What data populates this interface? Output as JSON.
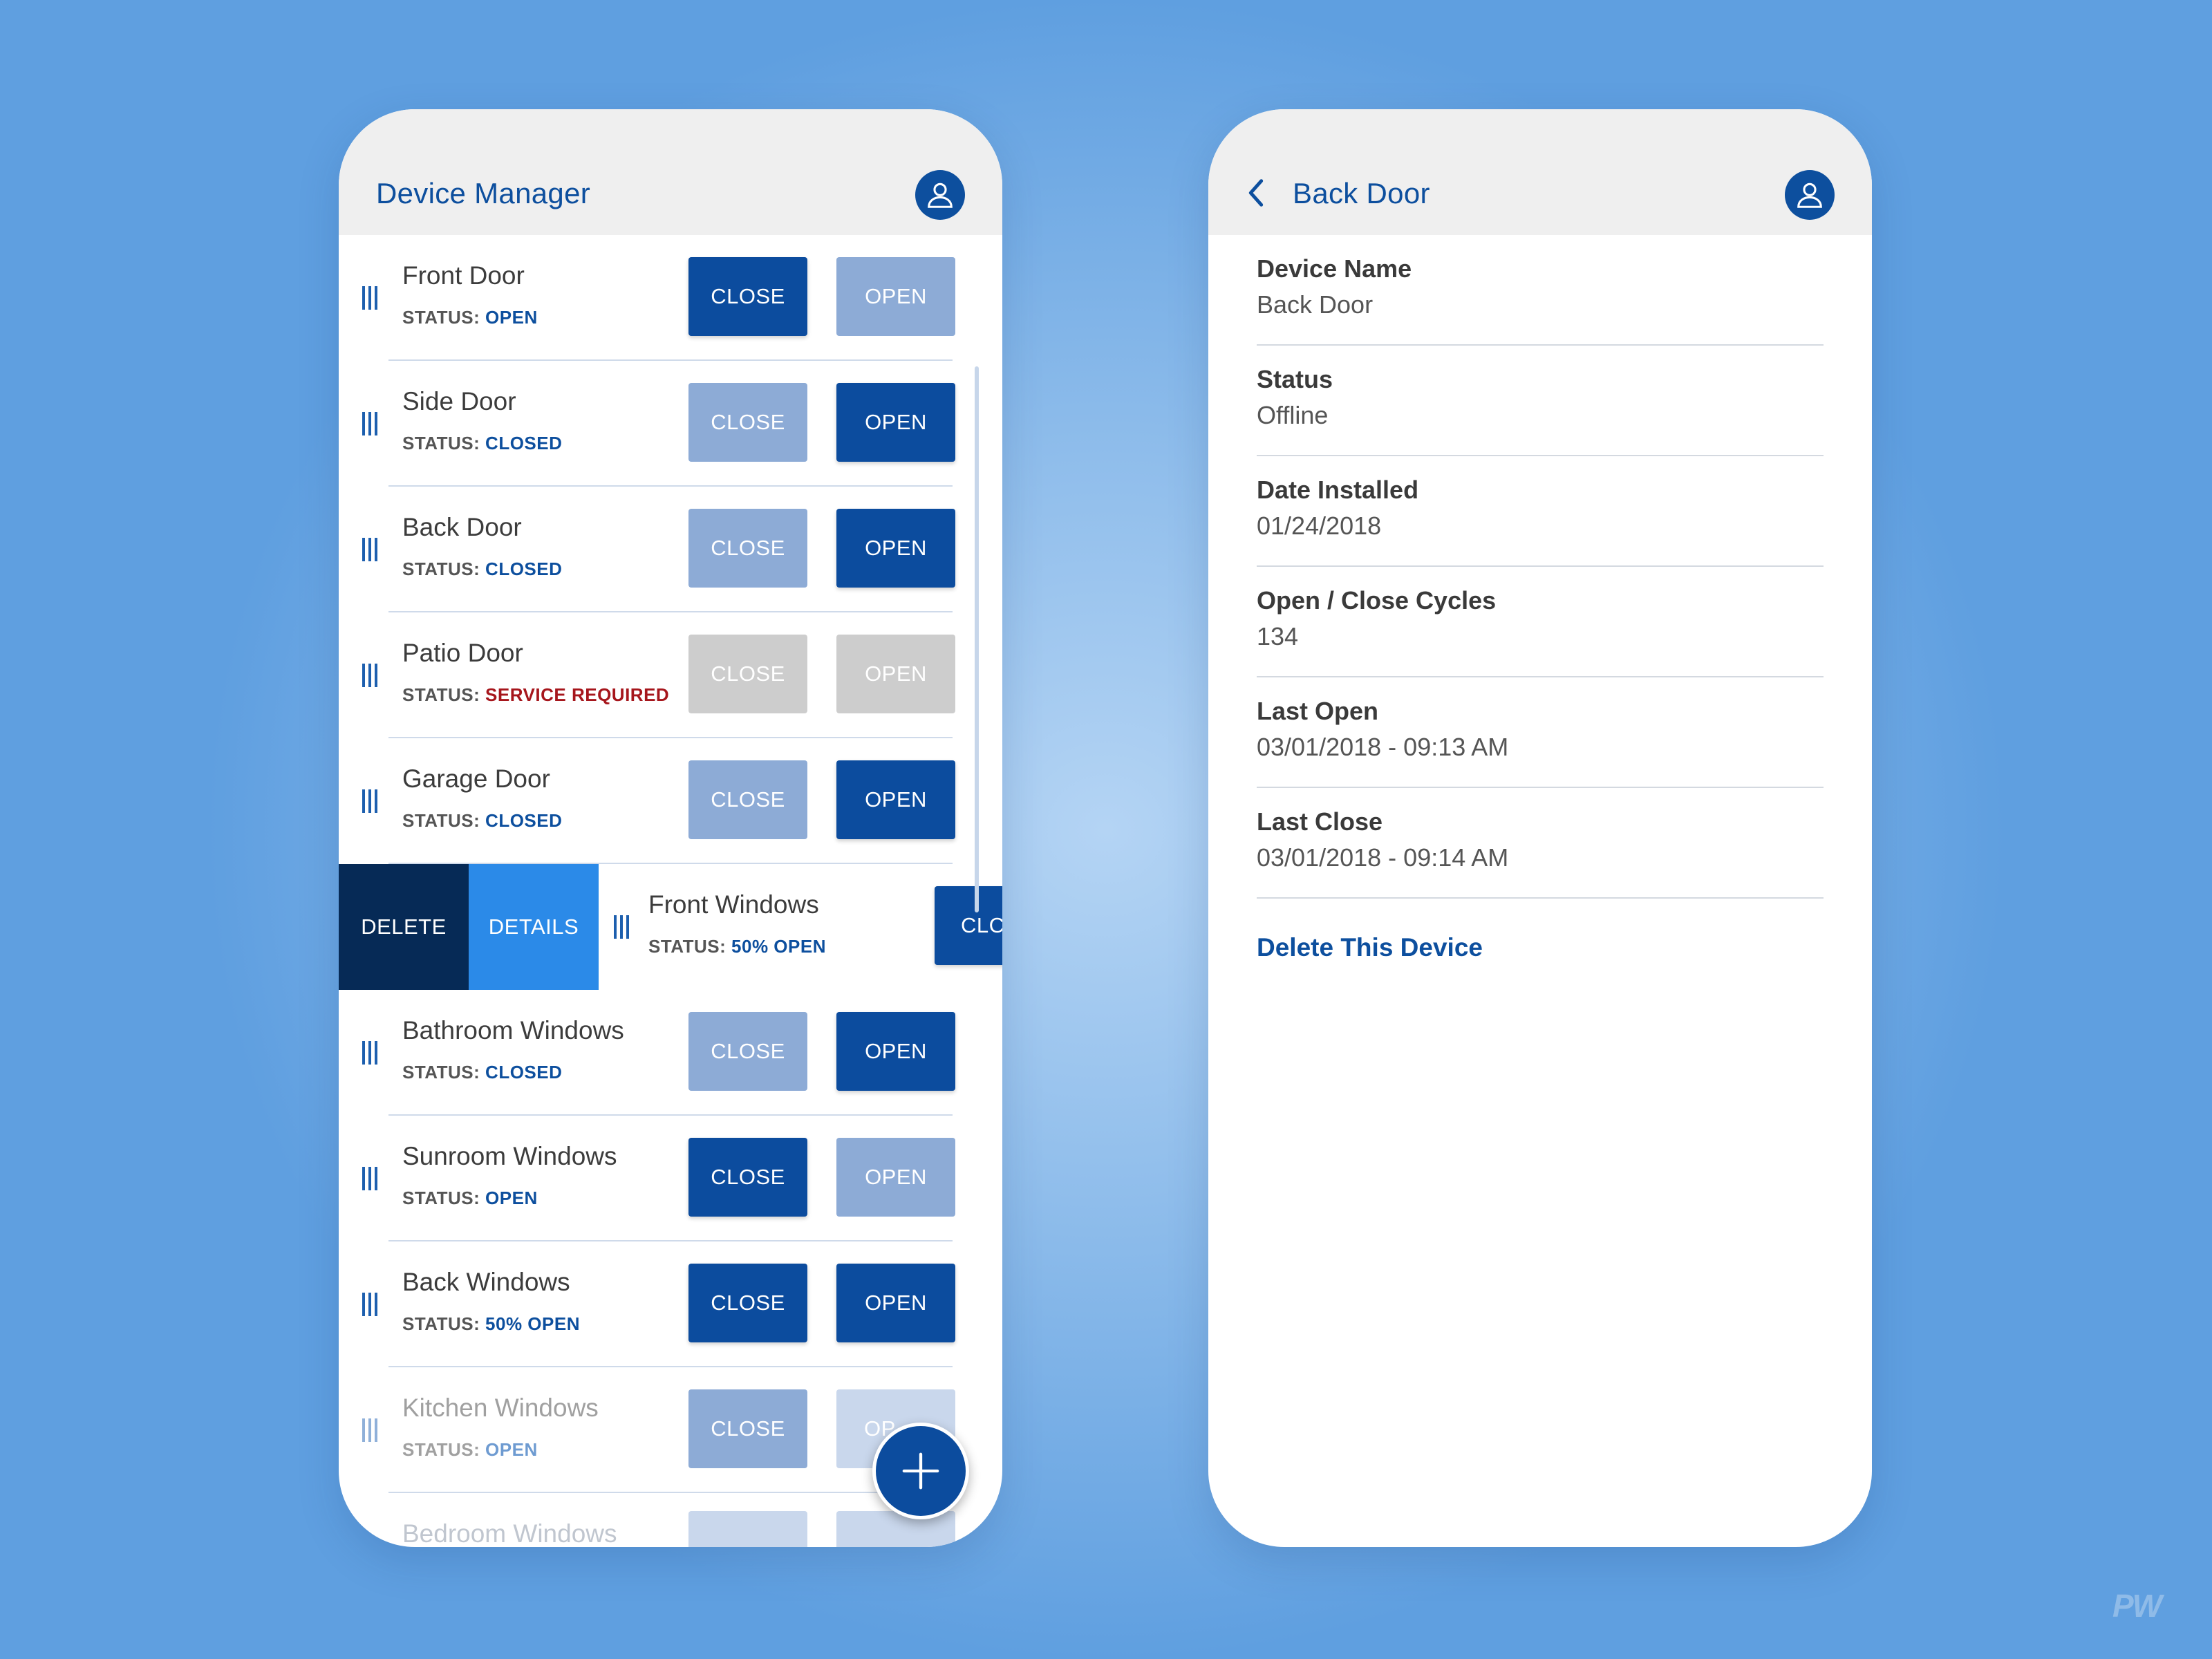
{
  "colors": {
    "primary": "#0c4c9e",
    "primary_light": "#8dabd6",
    "disabled": "#cdcdcd",
    "warning": "#a6161c",
    "swipe_delete": "#062a56",
    "swipe_details": "#2b8ae8"
  },
  "icons": {
    "avatar": "user-icon",
    "back": "chevron-left-icon",
    "drag": "drag-handle-icon",
    "add": "plus-icon"
  },
  "manager": {
    "title": "Device Manager",
    "status_prefix": "STATUS:",
    "close_label": "CLOSE",
    "open_label": "OPEN",
    "swipe": {
      "delete_label": "DELETE",
      "details_label": "DETAILS",
      "close_label_partial": "CLC"
    },
    "devices": [
      {
        "name": "Front Door",
        "status": "OPEN"
      },
      {
        "name": "Side Door",
        "status": "CLOSED"
      },
      {
        "name": "Back Door",
        "status": "CLOSED"
      },
      {
        "name": "Patio Door",
        "status": "SERVICE REQUIRED"
      },
      {
        "name": "Garage Door",
        "status": "CLOSED"
      },
      {
        "name": "Front Windows",
        "status": "50% OPEN"
      },
      {
        "name": "Bathroom Windows",
        "status": "CLOSED"
      },
      {
        "name": "Sunroom Windows",
        "status": "OPEN"
      },
      {
        "name": "Back Windows",
        "status": "50% OPEN"
      },
      {
        "name": "Kitchen Windows",
        "status": "OPEN"
      },
      {
        "name": "Bedroom Windows",
        "status": ""
      }
    ],
    "partial_open_label": "OP"
  },
  "details": {
    "title": "Back Door",
    "fields": [
      {
        "label": "Device Name",
        "value": "Back Door"
      },
      {
        "label": "Status",
        "value": "Offline"
      },
      {
        "label": "Date Installed",
        "value": "01/24/2018"
      },
      {
        "label": "Open / Close Cycles",
        "value": "134"
      },
      {
        "label": "Last Open",
        "value": "03/01/2018 - 09:13 AM"
      },
      {
        "label": "Last Close",
        "value": "03/01/2018 - 09:14 AM"
      }
    ],
    "delete_label": "Delete This Device"
  },
  "watermark": "PW"
}
